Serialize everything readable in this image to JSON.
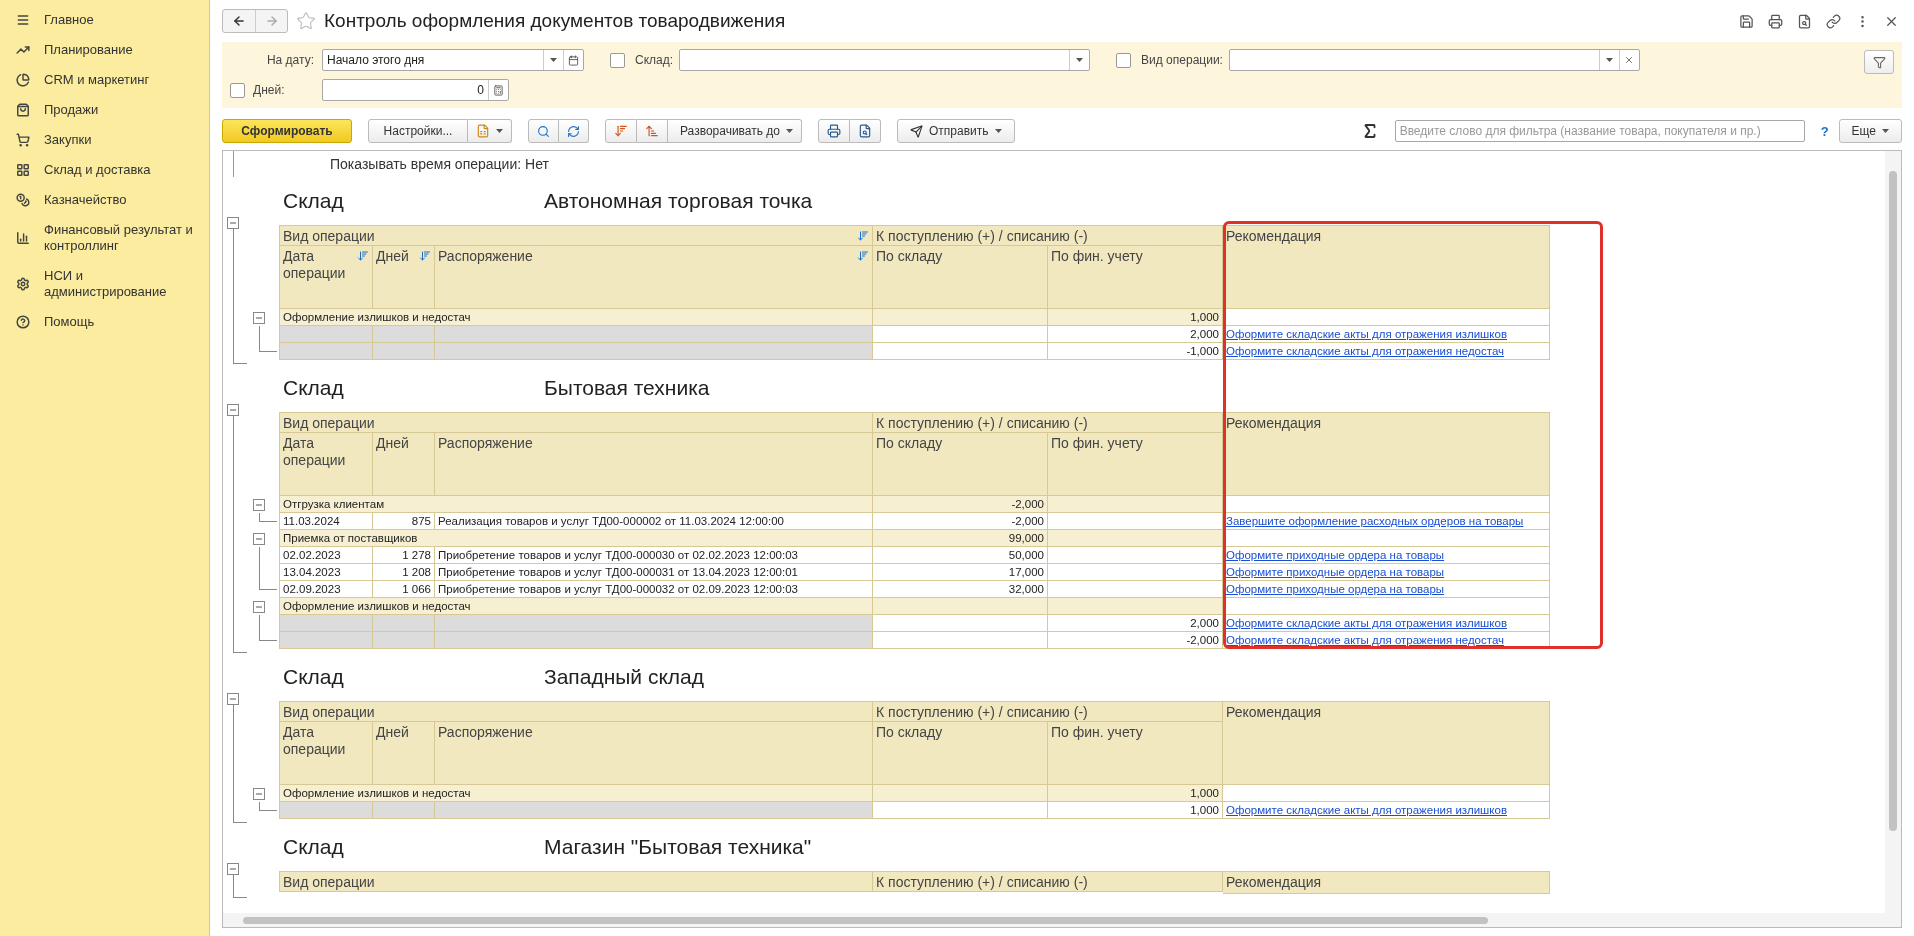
{
  "sidebar": {
    "items": [
      {
        "label": "Главное"
      },
      {
        "label": "Планирование"
      },
      {
        "label": "CRM и маркетинг"
      },
      {
        "label": "Продажи"
      },
      {
        "label": "Закупки"
      },
      {
        "label": "Склад и доставка"
      },
      {
        "label": "Казначейство"
      },
      {
        "label": "Финансовый результат и контроллинг"
      },
      {
        "label": "НСИ и администрирование"
      },
      {
        "label": "Помощь"
      }
    ]
  },
  "header": {
    "title": "Контроль оформления документов товародвижения"
  },
  "filters": {
    "date": {
      "label": "На дату:",
      "value": "Начало этого дня"
    },
    "warehouse": {
      "checked": false,
      "label": "Склад:"
    },
    "operation_type": {
      "checked": false,
      "label": "Вид операции:"
    },
    "days": {
      "checked": false,
      "label": "Дней:",
      "value": "0"
    }
  },
  "toolbar": {
    "generate": "Сформировать",
    "settings": "Настройки...",
    "expand_to": "Разворачивать до",
    "send": "Отправить",
    "search": {
      "placeholder": "Введите слово для фильтра (название товара, покупателя и пр.)"
    },
    "help": "?",
    "more": "Еще"
  },
  "report": {
    "parameter_line": "Показывать время операции: Нет",
    "sections": [
      {
        "label": "Склад",
        "name": "Автономная торговая точка",
        "expanded": true,
        "sort_icons": true,
        "header": {
          "operation": "Вид операции",
          "movement": "К поступлению (+) / списанию (-)",
          "recommendation": "Рекомендация",
          "columns": [
            "Дата операции",
            "Дней",
            "Распоряжение",
            "По складу",
            "По фин. учету"
          ]
        },
        "groups": [
          {
            "title": "Оформление излишков и недостач",
            "fin": "1,000",
            "expanded": true,
            "rows": [
              {
                "fin": "2,000",
                "recommendation": "Оформите складские акты для отражения излишков"
              },
              {
                "fin": "-1,000",
                "recommendation": "Оформите складские акты для отражения недостач"
              }
            ]
          }
        ]
      },
      {
        "label": "Склад",
        "name": "Бытовая техника",
        "expanded": true,
        "sort_icons": false,
        "header": {
          "operation": "Вид операции",
          "movement": "К поступлению (+) / списанию (-)",
          "recommendation": "Рекомендация",
          "columns": [
            "Дата операции",
            "Дней",
            "Распоряжение",
            "По складу",
            "По фин. учету"
          ]
        },
        "groups": [
          {
            "title": "Отгрузка клиентам",
            "warehouse": "-2,000",
            "expanded": true,
            "rows": [
              {
                "date": "11.03.2024",
                "days": "875",
                "order": "Реализация товаров и услуг ТД00-000002 от 11.03.2024 12:00:00",
                "warehouse": "-2,000",
                "recommendation": "Завершите оформление расходных ордеров на товары"
              }
            ]
          },
          {
            "title": "Приемка от поставщиков",
            "warehouse": "99,000",
            "expanded": true,
            "rows": [
              {
                "date": "02.02.2023",
                "days": "1 278",
                "order": "Приобретение товаров и услуг ТД00-000030 от 02.02.2023 12:00:03",
                "warehouse": "50,000",
                "recommendation": "Оформите приходные ордера на товары"
              },
              {
                "date": "13.04.2023",
                "days": "1 208",
                "order": "Приобретение товаров и услуг ТД00-000031 от 13.04.2023 12:00:01",
                "warehouse": "17,000",
                "recommendation": "Оформите приходные ордера на товары"
              },
              {
                "date": "02.09.2023",
                "days": "1 066",
                "order": "Приобретение товаров и услуг ТД00-000032 от 02.09.2023 12:00:03",
                "warehouse": "32,000",
                "recommendation": "Оформите приходные ордера на товары"
              }
            ]
          },
          {
            "title": "Оформление излишков и недостач",
            "expanded": true,
            "rows": [
              {
                "fin": "2,000",
                "recommendation": "Оформите складские акты для отражения излишков"
              },
              {
                "fin": "-2,000",
                "recommendation": "Оформите складские акты для отражения недостач"
              }
            ]
          }
        ]
      },
      {
        "label": "Склад",
        "name": "Западный склад",
        "expanded": true,
        "sort_icons": false,
        "header": {
          "operation": "Вид операции",
          "movement": "К поступлению (+) / списанию (-)",
          "recommendation": "Рекомендация",
          "columns": [
            "Дата операции",
            "Дней",
            "Распоряжение",
            "По складу",
            "По фин. учету"
          ]
        },
        "groups": [
          {
            "title": "Оформление излишков и недостач",
            "fin": "1,000",
            "expanded": true,
            "rows": [
              {
                "fin": "1,000",
                "recommendation": "Оформите складские акты для отражения излишков"
              }
            ]
          }
        ]
      },
      {
        "label": "Склад",
        "name": "Магазин \"Бытовая техника\"",
        "expanded": true,
        "sort_icons": false,
        "header": {
          "operation": "Вид операции",
          "movement": "К поступлению (+) / списанию (-)",
          "recommendation": "Рекомендация"
        }
      }
    ]
  }
}
